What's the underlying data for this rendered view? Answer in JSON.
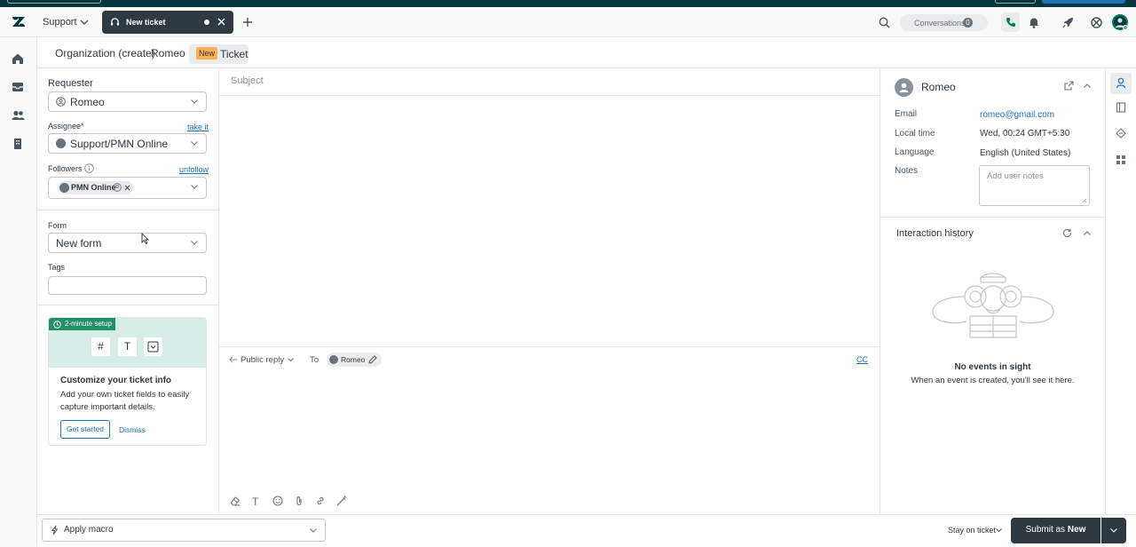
{
  "header": {
    "workspace": "Support",
    "active_tab": "New ticket",
    "conversations_label": "Conversations",
    "conversations_count": "0"
  },
  "breadcrumbs": {
    "organization": "Organization (create)",
    "user": "Romeo",
    "badge": "New",
    "ticket": "Ticket"
  },
  "left_panel": {
    "requester_label": "Requester",
    "requester_value": "Romeo",
    "assignee_label": "Assignee*",
    "assignee_link": "take it",
    "assignee_value": "Support/PMN Online",
    "followers_label": "Followers",
    "followers_link": "unfollow",
    "follower_chip": "PMN Online",
    "form_label": "Form",
    "form_value": "New form",
    "tags_label": "Tags",
    "tags_value": ""
  },
  "setup_card": {
    "badge": "2-minute setup",
    "title": "Customize your ticket info",
    "description": "Add your own ticket fields to easily capture important details.",
    "primary_button": "Get started",
    "secondary_button": "Dismiss"
  },
  "editor": {
    "subject_placeholder": "Subject",
    "reply_mode": "Public reply",
    "to_label": "To",
    "to_recipient": "Romeo",
    "cc_label": "CC"
  },
  "user_card": {
    "name": "Romeo",
    "email_label": "Email",
    "email_value": "romeo@gmail.com",
    "local_time_label": "Local time",
    "local_time_value": "Wed, 00:24 GMT+5:30",
    "language_label": "Language",
    "language_value": "English (United States)",
    "notes_label": "Notes",
    "notes_placeholder": "Add user notes"
  },
  "interaction_history": {
    "title": "Interaction history",
    "empty_title": "No events in sight",
    "empty_text": "When an event is created, you'll see it here."
  },
  "footer": {
    "macro_label": "Apply macro",
    "stay_label": "Stay on ticket",
    "submit_prefix": "Submit as ",
    "submit_status": "New"
  },
  "colors": {
    "brand_dark": "#03363d",
    "link_blue": "#1f73b7",
    "new_badge": "#ffb057",
    "submit_button": "#2f3941",
    "setup_band": "#d6ece6",
    "setup_badge": "#228f67"
  }
}
